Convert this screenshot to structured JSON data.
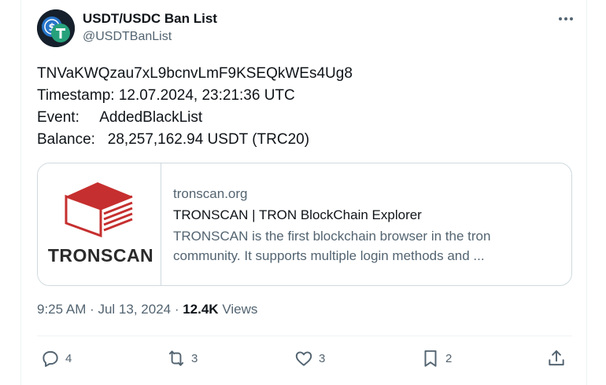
{
  "author": {
    "name": "USDT/USDC Ban List",
    "handle": "@USDTBanList"
  },
  "tweet": {
    "lines": [
      "TNVaKWQzau7xL9bcnvLmF9KSEQkWEs4Ug8",
      "Timestamp: 12.07.2024, 23:21:36 UTC",
      "Event:     AddedBlackList",
      "Balance:   28,257,162.94 USDT (TRC20)"
    ]
  },
  "link_card": {
    "thumbnail_word": "TRONSCAN",
    "domain": "tronscan.org",
    "title": "TRONSCAN | TRON BlockChain Explorer",
    "description_line1": "TRONSCAN is the first blockchain browser in the tron",
    "description_line2": "community. It supports multiple login methods and ..."
  },
  "meta": {
    "time": "9:25 AM · Jul 13, 2024",
    "separator": " · ",
    "views_count": "12.4K",
    "views_label": " Views"
  },
  "actions": {
    "replies": "4",
    "reposts": "3",
    "likes": "3",
    "bookmarks": "2"
  },
  "colors": {
    "text_primary": "#0f1419",
    "text_secondary": "#536471",
    "border": "#cfd9de",
    "tronscan_red": "#c62f2f",
    "usdt_green": "#26a17b",
    "usdc_blue": "#2775ca"
  },
  "icons": [
    "more-icon",
    "reply-icon",
    "repost-icon",
    "like-icon",
    "bookmark-icon",
    "share-icon"
  ]
}
